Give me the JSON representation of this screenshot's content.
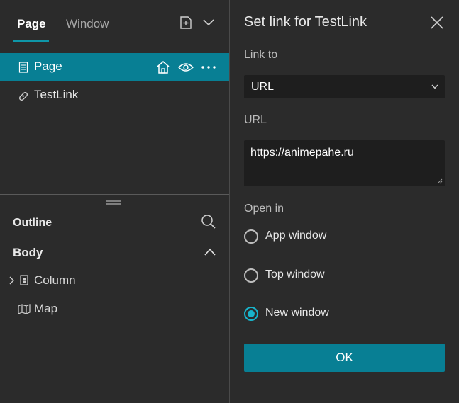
{
  "left_panel": {
    "tabs": [
      {
        "label": "Page",
        "active": true
      },
      {
        "label": "Window",
        "active": false
      }
    ],
    "pages": [
      {
        "label": "Page",
        "selected": true,
        "icons": [
          "document-icon",
          "home-icon",
          "eye-icon",
          "more-icon"
        ]
      },
      {
        "label": "TestLink",
        "selected": false,
        "icons": [
          "link-icon"
        ]
      }
    ],
    "outline": {
      "title": "Outline",
      "section": "Body",
      "items": [
        {
          "label": "Column",
          "icon": "column-icon",
          "expandable": true
        },
        {
          "label": "Map",
          "icon": "map-icon",
          "expandable": false
        }
      ]
    }
  },
  "dialog": {
    "title": "Set link for TestLink",
    "link_to_label": "Link to",
    "link_to_value": "URL",
    "url_label": "URL",
    "url_value": "https://animepahe.ru",
    "open_in_label": "Open in",
    "options": [
      {
        "label": "App window",
        "checked": false
      },
      {
        "label": "Top window",
        "checked": false
      },
      {
        "label": "New window",
        "checked": true
      }
    ],
    "ok_label": "OK"
  },
  "colors": {
    "accent": "#087f94",
    "radio_active": "#18b5cc",
    "background": "#2b2b2b",
    "input_background": "#1e1e1e"
  }
}
